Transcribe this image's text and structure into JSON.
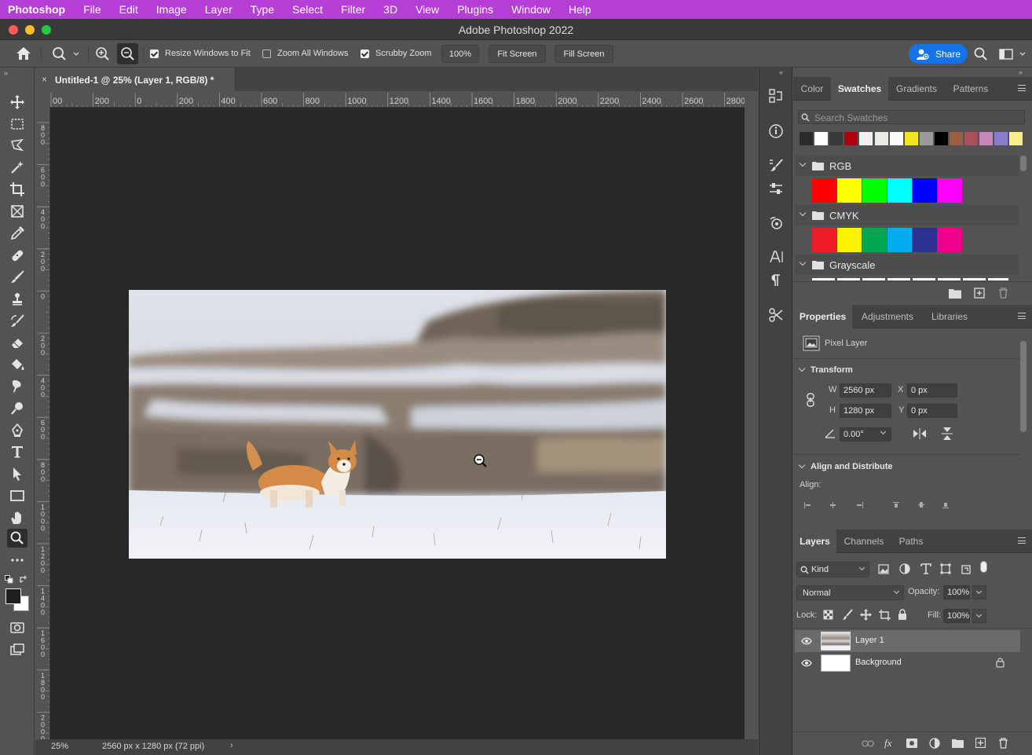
{
  "menubar": {
    "items": [
      "Photoshop",
      "File",
      "Edit",
      "Image",
      "Layer",
      "Type",
      "Select",
      "Filter",
      "3D",
      "View",
      "Plugins",
      "Window",
      "Help"
    ],
    "color": "#b53fd6"
  },
  "window": {
    "title": "Adobe Photoshop 2022"
  },
  "options": {
    "resize_windows": "Resize Windows to Fit",
    "zoom_all": "Zoom All Windows",
    "scrubby": "Scrubby Zoom",
    "zoom_value": "100%",
    "fit_screen": "Fit Screen",
    "fill_screen": "Fill Screen",
    "share": "Share",
    "resize_checked": true,
    "zoom_all_checked": false,
    "scrubby_checked": true
  },
  "document": {
    "tab_title": "Untitled-1 @ 25% (Layer 1, RGB/8) *",
    "ruler_h": [
      "00",
      "200",
      "0",
      "200",
      "400",
      "600",
      "800",
      "1000",
      "1200",
      "1400",
      "1600",
      "1800",
      "2000",
      "2200",
      "2400",
      "2600",
      "2800"
    ],
    "ruler_v": [
      "8\n0\n0",
      "6\n0\n0",
      "4\n0\n0",
      "2\n0\n0",
      "0",
      "2\n0\n0",
      "4\n0\n0",
      "6\n0\n0",
      "8\n0\n0",
      "1\n0\n0\n0",
      "1\n2\n0\n0",
      "1\n4\n0\n0",
      "1\n6\n0\n0",
      "1\n8\n0\n0",
      "2\n0\n0\n0"
    ],
    "status_zoom": "25%",
    "status_info": "2560 px x 1280 px (72 ppi)"
  },
  "swatches_panel": {
    "tabs": [
      "Color",
      "Swatches",
      "Gradients",
      "Patterns"
    ],
    "active_tab": "Swatches",
    "search_placeholder": "Search Swatches",
    "recent": [
      "#2b2b2b",
      "#ffffff",
      "#3a3a3a",
      "#b00012",
      "#f1f1f1",
      "#e8ebe6",
      "#fafafa",
      "#f3e524",
      "#9a9a9a",
      "#000000",
      "#9a6140",
      "#a8505d",
      "#c586b9",
      "#8a7cc8",
      "#f5ef8a"
    ],
    "groups": [
      {
        "name": "RGB",
        "colors": [
          "#ff0000",
          "#ffff00",
          "#00ff00",
          "#00ffff",
          "#0000ff",
          "#ff00ff"
        ]
      },
      {
        "name": "CMYK",
        "colors": [
          "#ee1c25",
          "#fff200",
          "#00a650",
          "#00aeef",
          "#2e3192",
          "#ec008c"
        ]
      },
      {
        "name": "Grayscale",
        "colors": []
      }
    ]
  },
  "properties_panel": {
    "tabs": [
      "Properties",
      "Adjustments",
      "Libraries"
    ],
    "active_tab": "Properties",
    "layer_type": "Pixel Layer",
    "transform": "Transform",
    "w_label": "W",
    "w": "2560 px",
    "h_label": "H",
    "h": "1280 px",
    "x_label": "X",
    "x": "0 px",
    "y_label": "Y",
    "y": "0 px",
    "angle": "0.00°",
    "align_section": "Align and Distribute",
    "align_label": "Align:"
  },
  "layers_panel": {
    "tabs": [
      "Layers",
      "Channels",
      "Paths"
    ],
    "active_tab": "Layers",
    "kind": "Kind",
    "blend_mode": "Normal",
    "opacity_label": "Opacity:",
    "opacity": "100%",
    "lock_label": "Lock:",
    "fill_label": "Fill:",
    "fill": "100%",
    "layers": [
      {
        "name": "Layer 1",
        "selected": true
      },
      {
        "name": "Background",
        "selected": false,
        "locked": true
      }
    ]
  }
}
